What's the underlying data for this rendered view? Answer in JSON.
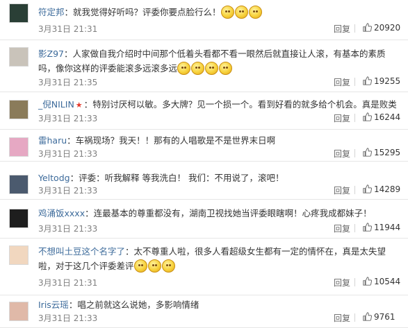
{
  "reply_label": "回复",
  "colors": {
    "username": "#3d6b9b",
    "text": "#333333",
    "meta": "#808080",
    "divider": "#e6e6e6"
  },
  "comments": [
    {
      "user": "符定邦",
      "text": "就我觉得好听吗？评委你要点脸行么！",
      "emoji_count": 3,
      "time": "3月31日 21:31",
      "likes": "20920",
      "avatar_color": "#2a3f36"
    },
    {
      "user": "影Z97",
      "text": "人家做自我介绍时中间那个低着头看都不看一眼然后就直接让人滚，有基本的素质吗，像你这样的评委能滚多远滚多远",
      "emoji_count": 4,
      "time": "3月31日 21:35",
      "likes": "19255",
      "avatar_color": "#c9c3ba"
    },
    {
      "user": "_倪NILIN",
      "badge": "★",
      "text": "特别讨厌柯以敏。多大牌？见一个损一个。看到好看的就多给个机会。真是败类",
      "emoji_count": 0,
      "time": "3月31日 21:33",
      "likes": "16244",
      "avatar_color": "#8a7b5a"
    },
    {
      "user": "雷haru",
      "text": "车祸现场？我天！！那有的人唱歌是不是世界末日啊",
      "emoji_count": 0,
      "time": "3月31日 21:33",
      "likes": "15295",
      "avatar_color": "#e6a8c3"
    },
    {
      "user": "Yeltodg",
      "text": "评委：听我解释 等我洗白！ 我们：不用说了，滚吧！",
      "emoji_count": 0,
      "time": "3月31日 21:33",
      "likes": "14289",
      "avatar_color": "#4b5a6e"
    },
    {
      "user": "鸡涌饭xxxx",
      "text": "连最基本的尊重都没有，湖南卫视找她当评委眼瞎啊！心疼我成都妹子！",
      "emoji_count": 0,
      "time": "3月31日 21:33",
      "likes": "11944",
      "avatar_color": "#1e1e1e"
    },
    {
      "user": "不想叫土豆这个名字了",
      "text": "太不尊重人啦，很多人看超级女生都有一定的情怀在，真是太失望啦，对于这几个评委差评",
      "emoji_count": 3,
      "time": "3月31日 21:31",
      "likes": "10544",
      "avatar_color": "#f1d7bf"
    },
    {
      "user": "Iris云瑶",
      "text": "唱之前就这么说她，多影响情绪",
      "emoji_count": 0,
      "time": "3月31日 21:33",
      "likes": "9761",
      "avatar_color": "#e0b9a8"
    }
  ]
}
